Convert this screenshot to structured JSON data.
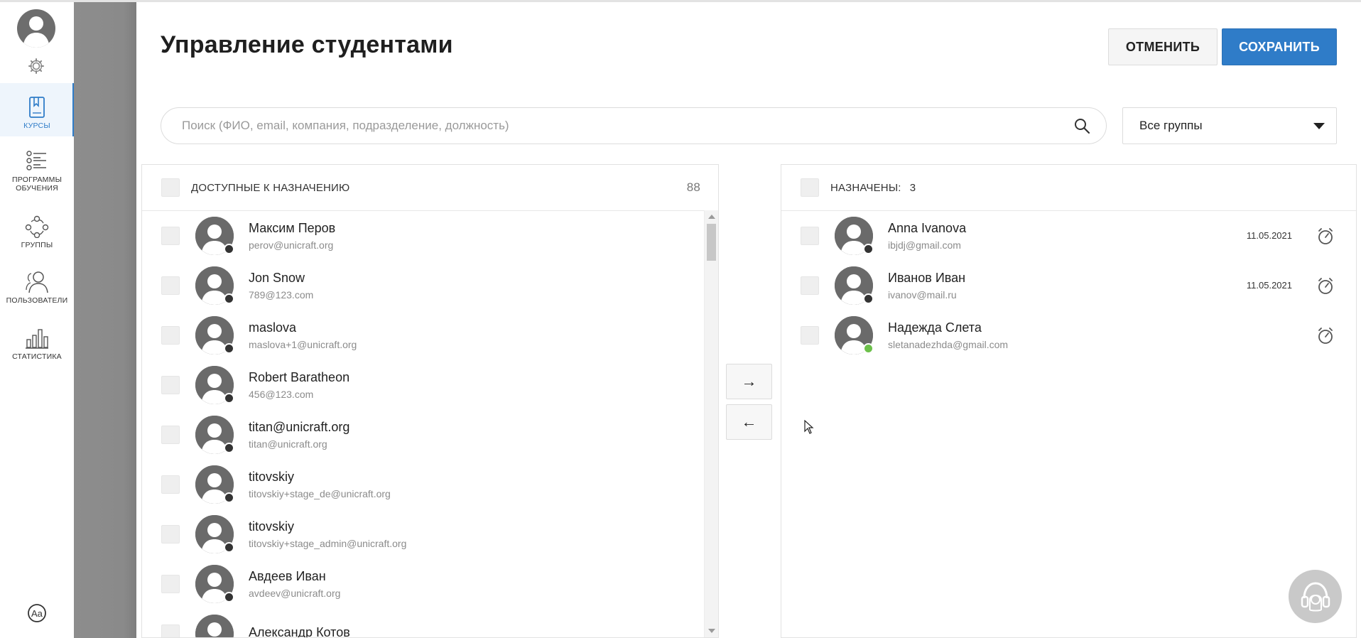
{
  "sidebar": {
    "items": [
      {
        "label": "КУРСЫ",
        "icon": "book-icon",
        "active": true
      },
      {
        "label": "ПРОГРАММЫ ОБУЧЕНИЯ",
        "icon": "checklist-icon",
        "active": false
      },
      {
        "label": "ГРУППЫ",
        "icon": "group-icon",
        "active": false
      },
      {
        "label": "ПОЛЬЗОВАТЕЛИ",
        "icon": "users-icon",
        "active": false
      },
      {
        "label": "СТАТИСТИКА",
        "icon": "bar-chart-icon",
        "active": false
      }
    ]
  },
  "header": {
    "title": "Управление студентами",
    "cancel_label": "ОТМЕНИТЬ",
    "save_label": "СОХРАНИТЬ"
  },
  "search": {
    "placeholder": "Поиск (ФИО, email, компания, подразделение, должность)",
    "value": ""
  },
  "group_filter": {
    "selected": "Все группы"
  },
  "available": {
    "title": "ДОСТУПНЫЕ К НАЗНАЧЕНИЮ",
    "count": "88",
    "items": [
      {
        "name": "Максим Перов",
        "email": "perov@unicraft.org",
        "online": false
      },
      {
        "name": "Jon Snow",
        "email": "789@123.com",
        "online": false
      },
      {
        "name": "maslova",
        "email": "maslova+1@unicraft.org",
        "online": false
      },
      {
        "name": "Robert Baratheon",
        "email": "456@123.com",
        "online": false
      },
      {
        "name": "titan@unicraft.org",
        "email": "titan@unicraft.org",
        "online": false
      },
      {
        "name": "titovskiy",
        "email": "titovskiy+stage_de@unicraft.org",
        "online": false
      },
      {
        "name": "titovskiy",
        "email": "titovskiy+stage_admin@unicraft.org",
        "online": false
      },
      {
        "name": "Авдеев Иван",
        "email": "avdeev@unicraft.org",
        "online": false
      },
      {
        "name": "Александр Котов",
        "email": "",
        "online": false
      }
    ]
  },
  "assigned": {
    "title": "НАЗНАЧЕНЫ:",
    "count": "3",
    "items": [
      {
        "name": "Anna Ivanova",
        "email": "ibjdj@gmail.com",
        "date": "11.05.2021",
        "online": false
      },
      {
        "name": "Иванов Иван",
        "email": "ivanov@mail.ru",
        "date": "11.05.2021",
        "online": false
      },
      {
        "name": "Надежда Слета",
        "email": "sletanadezhda@gmail.com",
        "date": "",
        "online": true
      }
    ]
  },
  "transfer": {
    "move_right": "→",
    "move_left": "←"
  },
  "colors": {
    "accent": "#2f7cc8",
    "online": "#6cc04a",
    "offline": "#333333"
  }
}
